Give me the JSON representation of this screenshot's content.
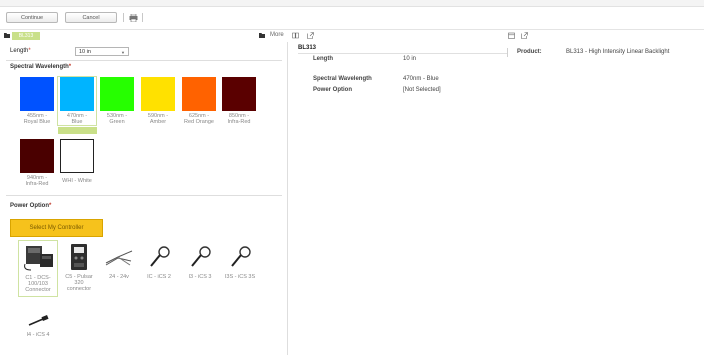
{
  "toolbar": {
    "continue_label": "Continue",
    "cancel_label": "Cancel"
  },
  "subheader": {
    "tag": "BL313",
    "more_label": "More"
  },
  "form": {
    "length_label": "Length",
    "length_required_mark": "*",
    "length_value": "10 in",
    "wavelength_title": "Spectral Wavelength",
    "wavelength_required_mark": "*",
    "wavelengths": [
      {
        "line1": "455nm -",
        "line2": "Royal Blue",
        "color": "#0052ff"
      },
      {
        "line1": "470nm -",
        "line2": "Blue",
        "color": "#00b4ff"
      },
      {
        "line1": "530nm -",
        "line2": "Green",
        "color": "#26ff00"
      },
      {
        "line1": "590nm -",
        "line2": "Amber",
        "color": "#ffe100"
      },
      {
        "line1": "625nm -",
        "line2": "Red Orange",
        "color": "#ff6200"
      },
      {
        "line1": "850nm -",
        "line2": "Infra-Red",
        "color": "#5a0000"
      },
      {
        "line1": "940nm -",
        "line2": "Infra-Red",
        "color": "#4a0000"
      },
      {
        "line1": "WHI - White",
        "line2": "",
        "color": "#ffffff"
      }
    ],
    "selected_wavelength": "470nm - Blue",
    "power_title": "Power Option",
    "power_required_mark": "*",
    "controller_button": "Select My Controller",
    "power_options": [
      {
        "lines": [
          "C1 - DCS-",
          "100/103",
          "Connector"
        ],
        "icon": "controller-box-icon"
      },
      {
        "lines": [
          "C5 - Pulsar",
          "320",
          "connector"
        ],
        "icon": "pulsar-controller-icon"
      },
      {
        "lines": [
          "24 - 24v"
        ],
        "icon": "flying-leads-icon"
      },
      {
        "lines": [
          "IC - iCS 2"
        ],
        "icon": "coiled-cable-icon"
      },
      {
        "lines": [
          "I3 - iCS 3"
        ],
        "icon": "coiled-cable-icon"
      },
      {
        "lines": [
          "I3S - iCS 3S"
        ],
        "icon": "coiled-cable-icon"
      },
      {
        "lines": [
          "I4 - iCS 4"
        ],
        "icon": "cable-plug-icon"
      }
    ]
  },
  "summary": {
    "title": "BL313",
    "rows": [
      {
        "label": "Length",
        "value": "10 in"
      },
      {
        "label": "Spectral Wavelength",
        "value": "470nm - Blue"
      },
      {
        "label": "Power Option",
        "value": "[Not Selected]"
      }
    ],
    "product_label": "Product:",
    "product_value": "BL313 - High Intensity Linear Backlight"
  },
  "colors": {
    "accent_green": "#c9e089",
    "controller_yellow": "#f6c21c",
    "required_red": "#c0392b"
  }
}
